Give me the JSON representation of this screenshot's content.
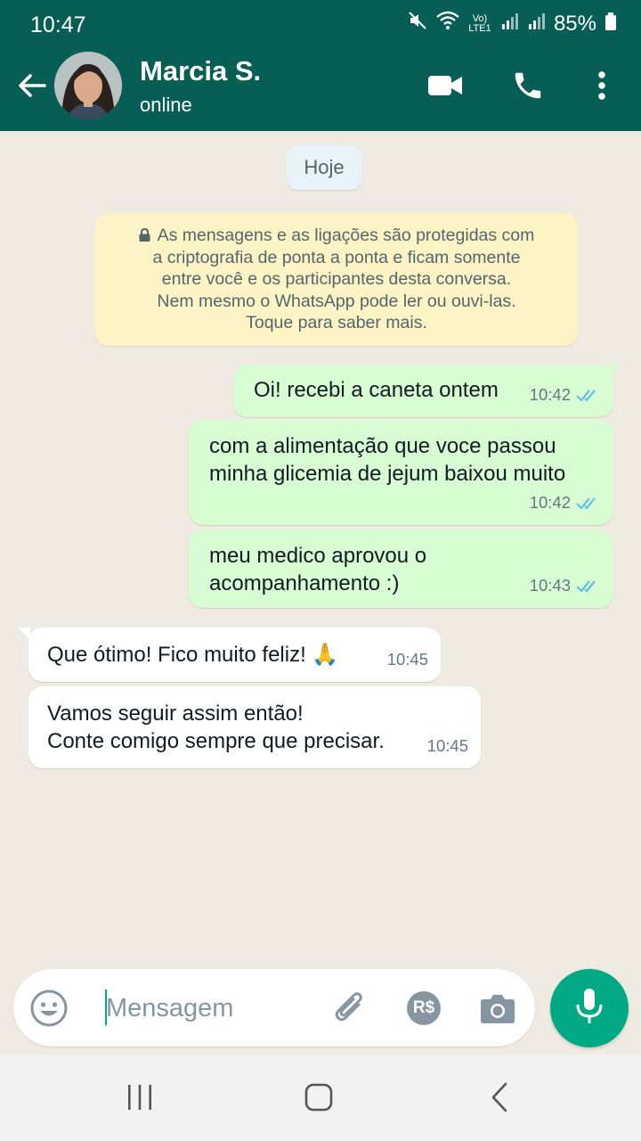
{
  "status_bar": {
    "time": "10:47",
    "battery": "85%",
    "network": "Vo) LTE1"
  },
  "contact": {
    "name": "Marcia S.",
    "status": "online"
  },
  "chat": {
    "date_label": "Hoje",
    "encryption_notice": [
      "As mensagens e as ligações são protegidas com",
      "a criptografia de ponta a ponta e ficam somente",
      "entre você e os participantes desta conversa.",
      "Nem mesmo o WhatsApp pode ler ou ouvi-las.",
      "Toque para saber mais."
    ],
    "messages": [
      {
        "direction": "out",
        "lines": [
          "Oi! recebi a caneta ontem"
        ],
        "time": "10:42",
        "status": "read"
      },
      {
        "direction": "out",
        "lines": [
          "com a alimentação que voce passou",
          "minha glicemia de jejum baixou muito"
        ],
        "time": "10:42",
        "status": "read"
      },
      {
        "direction": "out",
        "lines": [
          "meu medico aprovou o",
          "acompanhamento :)"
        ],
        "time": "10:43",
        "status": "read"
      },
      {
        "direction": "in",
        "lines": [
          "Que ótimo! Fico muito feliz! 🙏"
        ],
        "time": "10:45"
      },
      {
        "direction": "in",
        "lines": [
          "Vamos seguir assim então!",
          "Conte comigo sempre que precisar."
        ],
        "time": "10:45"
      }
    ]
  },
  "composer": {
    "placeholder": "Mensagem",
    "value": "",
    "payment_label": "R$"
  },
  "colors": {
    "header": "#075e54",
    "outgoing_bubble": "#d9fdd3",
    "incoming_bubble": "#ffffff",
    "accent": "#00a884",
    "read_ticks": "#53bdeb",
    "notice_bg": "#fdf4c5",
    "chat_bg": "#efeae2"
  },
  "icons": {
    "back": "arrow-left-icon",
    "video": "video-camera-icon",
    "call": "phone-icon",
    "menu": "more-vertical-icon",
    "emoji": "emoji-icon",
    "attach": "paperclip-icon",
    "payment": "payment-icon",
    "camera": "camera-icon",
    "mic": "microphone-icon"
  }
}
